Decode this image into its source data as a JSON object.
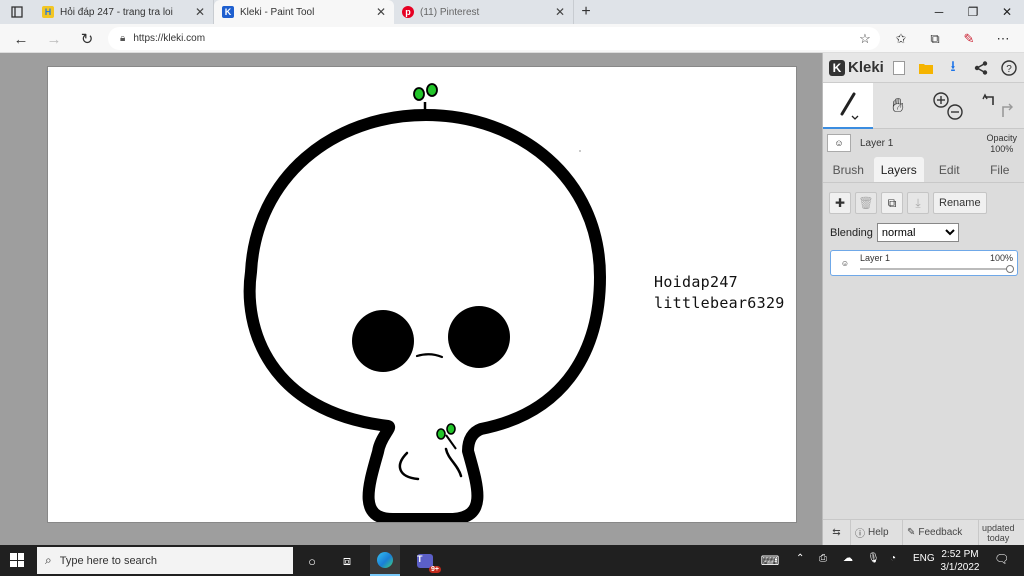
{
  "browser": {
    "tabs": [
      {
        "title": "Hỏi đáp 247 - trang tra loi",
        "active": false,
        "favicon_color": "#2b7bd6"
      },
      {
        "title": "Kleki - Paint Tool",
        "active": true,
        "favicon_color": "#1e5fcf"
      },
      {
        "title": "(11) Pinterest",
        "active": false,
        "favicon_color": "#e60023"
      }
    ],
    "url": "https://kleki.com"
  },
  "canvas": {
    "handle_lines": [
      "Hoidap247",
      "littlebear6329"
    ],
    "colors": {
      "outline": "#000000",
      "blush": "#ff3b3b",
      "sprout": "#22c52a"
    }
  },
  "panel": {
    "logo_text": "Kleki",
    "layer_header": {
      "name": "Layer 1",
      "opacity_label": "Opacity",
      "opacity_value": "100%"
    },
    "tabs": [
      "Brush",
      "Layers",
      "Edit",
      "File"
    ],
    "active_tab": "Layers",
    "rename_label": "Rename",
    "blending_label": "Blending",
    "blending_value": "normal",
    "layer_item": {
      "name": "Layer 1",
      "opacity": "100%"
    },
    "footer": {
      "help": "Help",
      "feedback": "Feedback",
      "updated_line1": "updated",
      "updated_line2": "today"
    }
  },
  "taskbar": {
    "search_placeholder": "Type here to search",
    "language": "ENG",
    "time": "2:52 PM",
    "date": "3/1/2022",
    "teams_badge": "9+"
  }
}
